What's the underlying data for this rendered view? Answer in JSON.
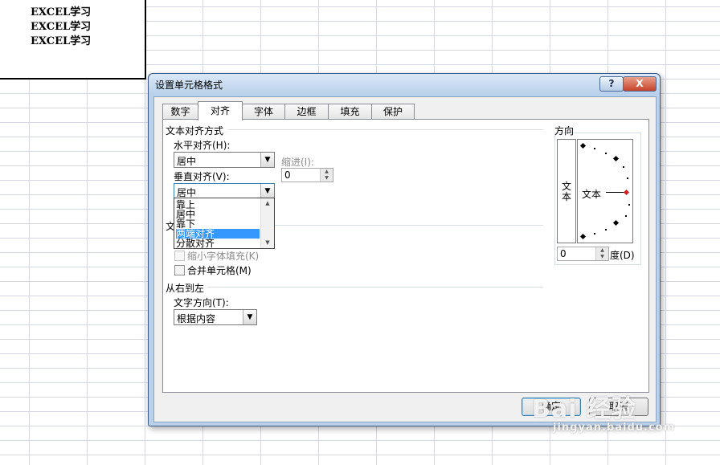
{
  "sheet": {
    "cells": [
      "EXCEL学习",
      "EXCEL学习",
      "EXCEL学习"
    ]
  },
  "dialog": {
    "title": "设置单元格格式",
    "help_label": "?",
    "close_label": "X",
    "tabs": [
      {
        "label": "数字",
        "active": false
      },
      {
        "label": "对齐",
        "active": true
      },
      {
        "label": "字体",
        "active": false
      },
      {
        "label": "边框",
        "active": false
      },
      {
        "label": "填充",
        "active": false
      },
      {
        "label": "保护",
        "active": false
      }
    ],
    "text_alignment": {
      "group_label": "文本对齐方式",
      "horizontal_label": "水平对齐(H):",
      "horizontal_value": "居中",
      "indent_label": "缩进(I):",
      "indent_value": "0",
      "vertical_label": "垂直对齐(V):",
      "vertical_value": "居中",
      "vertical_options": [
        "靠上",
        "居中",
        "靠下",
        "两端对齐",
        "分散对齐"
      ],
      "vertical_highlighted": "两端对齐"
    },
    "text_control": {
      "group_label": "文本控制",
      "shrink_label": "缩小字体填充(K)",
      "merge_label": "合并单元格(M)"
    },
    "rtl": {
      "group_label": "从右到左",
      "direction_label": "文字方向(T):",
      "direction_value": "根据内容"
    },
    "orientation": {
      "group_label": "方向",
      "vertical_text": "文本",
      "dial_text": "文本",
      "degrees_value": "0",
      "degrees_label": "度(D)"
    },
    "buttons": {
      "ok": "确定",
      "cancel": "取消"
    }
  },
  "watermark": {
    "main": "Bai 经验",
    "sub": "jingyan.baidu.com"
  }
}
